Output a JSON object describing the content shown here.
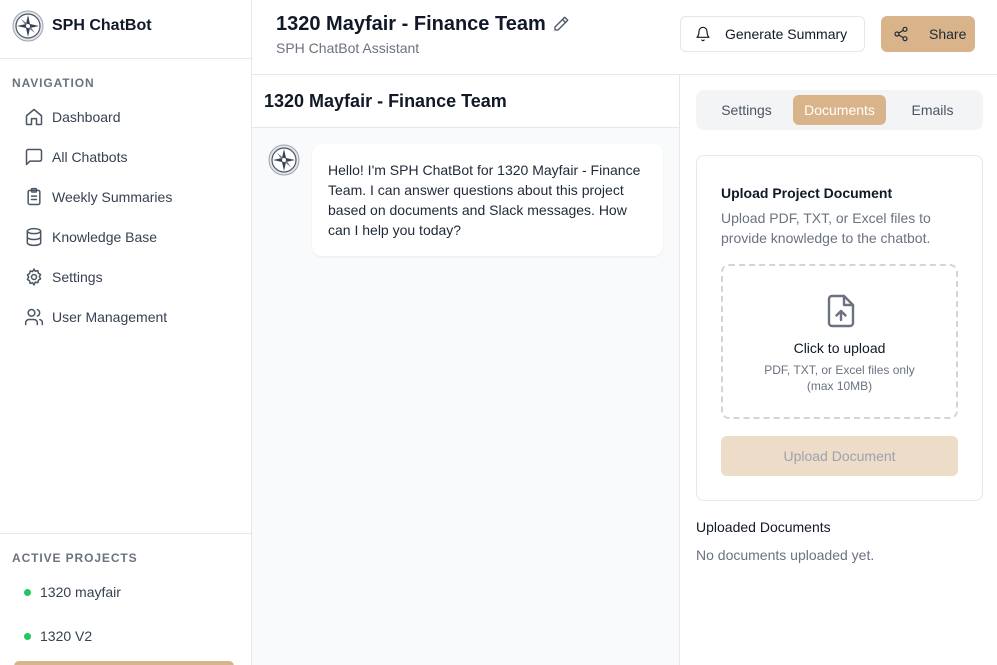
{
  "brand": {
    "name": "SPH ChatBot"
  },
  "sidebar": {
    "nav_heading": "NAVIGATION",
    "items": [
      {
        "label": "Dashboard",
        "icon": "home-icon"
      },
      {
        "label": "All Chatbots",
        "icon": "message-square-icon"
      },
      {
        "label": "Weekly Summaries",
        "icon": "clipboard-list-icon"
      },
      {
        "label": "Knowledge Base",
        "icon": "database-icon"
      },
      {
        "label": "Settings",
        "icon": "gear-icon"
      },
      {
        "label": "User Management",
        "icon": "users-icon"
      }
    ],
    "projects_heading": "ACTIVE PROJECTS",
    "projects": [
      {
        "label": "1320 mayfair",
        "status_color": "#22c55e"
      },
      {
        "label": "1320 V2",
        "status_color": "#22c55e"
      }
    ]
  },
  "header": {
    "title": "1320 Mayfair - Finance Team",
    "subtitle": "SPH ChatBot Assistant",
    "summary_button": "Generate Summary",
    "share_button": "Share"
  },
  "chat": {
    "title": "1320 Mayfair - Finance Team",
    "messages": [
      {
        "sender": "bot",
        "text": "Hello! I'm SPH ChatBot for 1320 Mayfair - Finance Team. I can answer questions about this project based on documents and Slack messages. How can I help you today?"
      }
    ]
  },
  "panel": {
    "tabs": [
      {
        "label": "Settings",
        "active": false
      },
      {
        "label": "Documents",
        "active": true
      },
      {
        "label": "Emails",
        "active": false
      }
    ],
    "upload_card": {
      "title": "Upload Project Document",
      "description": "Upload PDF, TXT, or Excel files to provide knowledge to the chatbot.",
      "dropzone_title": "Click to upload",
      "dropzone_hint": "PDF, TXT, or Excel files only (max 10MB)",
      "upload_button": "Upload Document"
    },
    "uploaded_title": "Uploaded Documents",
    "uploaded_empty": "No documents uploaded yet."
  },
  "colors": {
    "accent": "#d9b48a",
    "accent_disabled": "#ecdcc8",
    "status_active": "#22c55e"
  }
}
